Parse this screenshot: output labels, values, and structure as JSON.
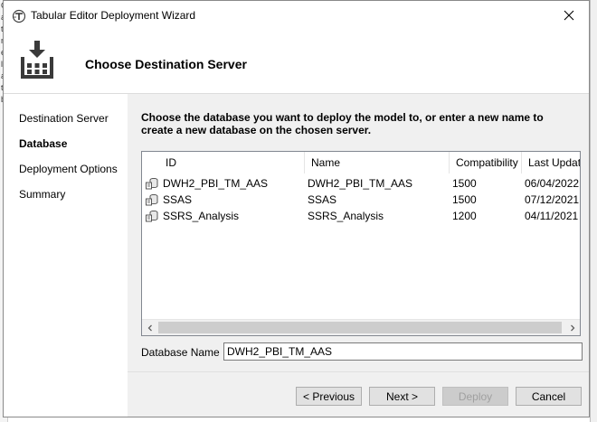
{
  "window": {
    "title": "Tabular Editor Deployment Wizard"
  },
  "header": {
    "title": "Choose Destination Server"
  },
  "steps": [
    {
      "label": "Destination Server",
      "active": false
    },
    {
      "label": "Database",
      "active": true
    },
    {
      "label": "Deployment Options",
      "active": false
    },
    {
      "label": "Summary",
      "active": false
    }
  ],
  "instruction": "Choose the database you want to deploy the model to, or enter a new name to create a new database on the chosen server.",
  "list": {
    "columns": [
      "ID",
      "Name",
      "Compatibility",
      "Last Update"
    ],
    "rows": [
      {
        "id": "DWH2_PBI_TM_AAS",
        "name": "DWH2_PBI_TM_AAS",
        "compatibility": "1500",
        "last_update": "06/04/2022"
      },
      {
        "id": "SSAS",
        "name": "SSAS",
        "compatibility": "1500",
        "last_update": "07/12/2021"
      },
      {
        "id": "SSRS_Analysis",
        "name": "SSRS_Analysis",
        "compatibility": "1200",
        "last_update": "04/11/2021"
      }
    ]
  },
  "database_name": {
    "label": "Database Name",
    "value": "DWH2_PBI_TM_AAS"
  },
  "buttons": {
    "previous": "< Previous",
    "next": "Next >",
    "deploy": "Deploy",
    "cancel": "Cancel"
  },
  "icons": {
    "app": "tabular-editor-icon",
    "header": "deploy-icon",
    "row": "database-icon",
    "close": "close-icon"
  },
  "colors": {
    "content_bg": "#f0f0f0",
    "disabled_text": "#a0a0a0"
  }
}
